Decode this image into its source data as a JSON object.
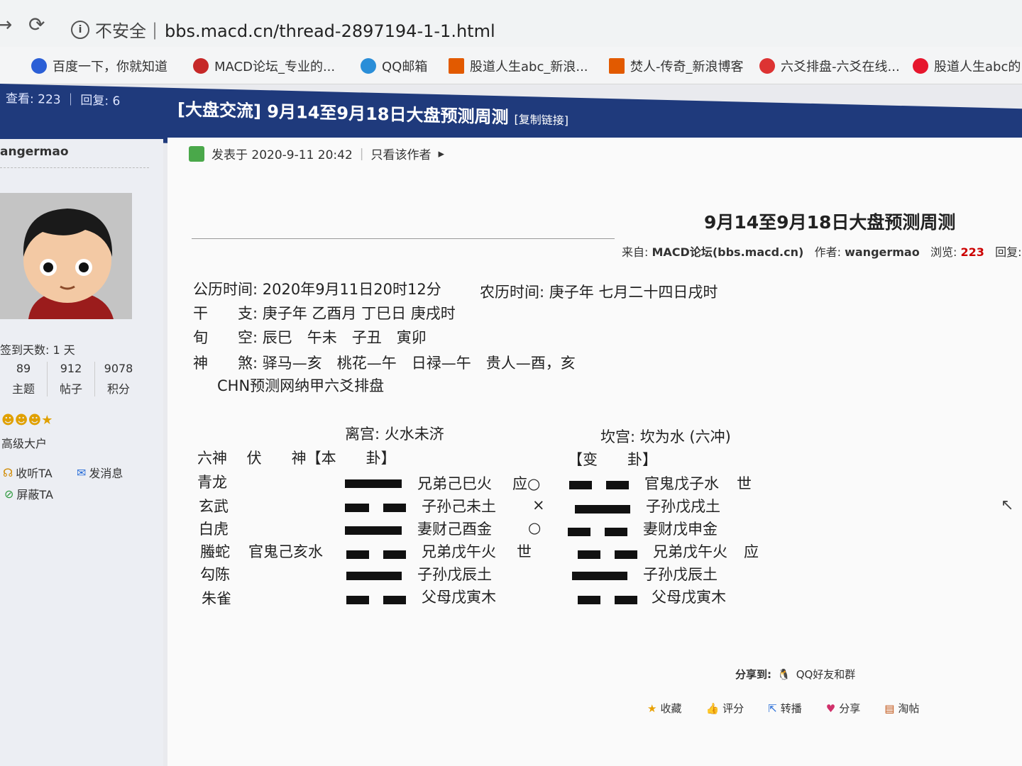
{
  "browser": {
    "security_label": "不安全",
    "url": "bbs.macd.cn/thread-2897194-1-1.html",
    "bookmarks": [
      "百度一下，你就知道",
      "MACD论坛_专业的...",
      "QQ邮箱",
      "股道人生abc_新浪...",
      "焚人-传奇_新浪博客",
      "六爻排盘-六爻在线...",
      "股道人生abc的"
    ]
  },
  "forum": {
    "views_label": "查看: 223",
    "replies_label": "回复: 6",
    "thread_title": "[大盘交流] 9月14至9月18日大盘预测周测",
    "copy_link": "[复制链接]"
  },
  "author": {
    "name": "angermao",
    "checkin": "签到天数: 1 天",
    "stats": [
      {
        "value": "89",
        "label": "主题"
      },
      {
        "value": "912",
        "label": "帖子"
      },
      {
        "value": "9078",
        "label": "积分"
      }
    ],
    "rank": "高级大户",
    "follow": "收听TA",
    "message": "发消息",
    "block": "屏蔽TA"
  },
  "post": {
    "posted_at": "发表于 2020-9-11 20:42",
    "only_author": "只看该作者",
    "title": "9月14至9月18日大盘预测周测",
    "source_prefix": "来自:",
    "source_value": "MACD论坛(bbs.macd.cn)",
    "author_prefix": "作者:",
    "author_value": "wangermao",
    "views_prefix": "浏览:",
    "views_value": "223",
    "replies_prefix": "回复:"
  },
  "divination": {
    "solar_time": "公历时间: 2020年9月11日20时12分",
    "lunar_time": "农历时间: 庚子年 七月二十四日戌时",
    "ganzhi": "干　　支: 庚子年 乙酉月 丁巳日 庚戌时",
    "xunkong": "旬　　空: 辰巳　午未　子丑　寅卯",
    "shensha": "神　　煞: 驿马—亥　桃花—午　日禄—午　贵人—酉，亥",
    "source": "CHN预测网纳甲六爻排盘",
    "left_palace": "离宫: 火水未济",
    "right_palace": "坎宫: 坎为水 (六冲)",
    "header_left": "六神　 伏　　神【本　　卦】",
    "header_right": "【变　　卦】",
    "rows": [
      {
        "god": "青龙",
        "hidden": "",
        "main": "兄弟己巳火",
        "mark": "应○",
        "changed": "官鬼戊子水",
        "cmark": "世"
      },
      {
        "god": "玄武",
        "hidden": "",
        "main": "子孙己未土",
        "mark": "×",
        "changed": "子孙戊戌土",
        "cmark": ""
      },
      {
        "god": "白虎",
        "hidden": "",
        "main": "妻财己酉金",
        "mark": "○",
        "changed": "妻财戊申金",
        "cmark": ""
      },
      {
        "god": "螣蛇",
        "hidden": "官鬼己亥水",
        "main": "兄弟戊午火",
        "mark": "世",
        "changed": "兄弟戊午火",
        "cmark": "应"
      },
      {
        "god": "勾陈",
        "hidden": "",
        "main": "子孙戊辰土",
        "mark": "",
        "changed": "子孙戊辰土",
        "cmark": ""
      },
      {
        "god": "朱雀",
        "hidden": "",
        "main": "父母戊寅木",
        "mark": "",
        "changed": "父母戊寅木",
        "cmark": ""
      }
    ]
  },
  "footer": {
    "share_to": "分享到:",
    "share_qq": "QQ好友和群",
    "actions": [
      "收藏",
      "评分",
      "转播",
      "分享",
      "淘帖"
    ]
  }
}
